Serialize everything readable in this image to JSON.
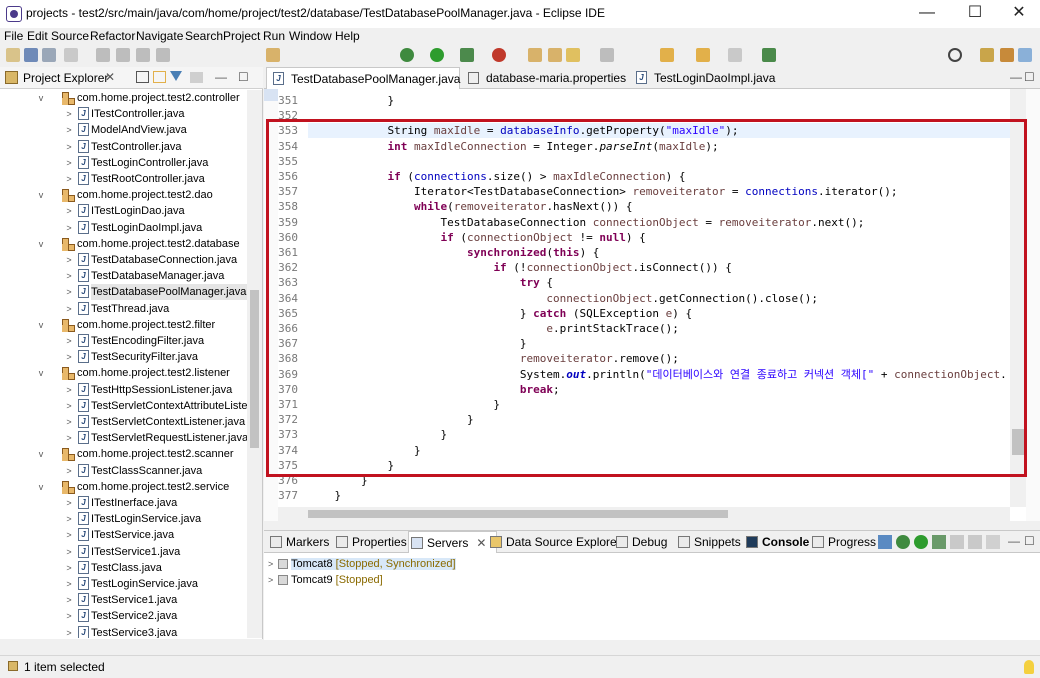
{
  "window": {
    "title": "projects - test2/src/main/java/com/home/project/test2/database/TestDatabasePoolManager.java - Eclipse IDE",
    "minimize": "—",
    "maximize": "☐",
    "close": "✕"
  },
  "menu": [
    "File",
    "Edit",
    "Source",
    "Refactor",
    "Navigate",
    "Search",
    "Project",
    "Run",
    "Window",
    "Help"
  ],
  "explorer": {
    "title": "Project Explorer",
    "items": [
      {
        "type": "pkg",
        "label": "com.home.project.test2.controller"
      },
      {
        "type": "file",
        "label": "ITestController.java"
      },
      {
        "type": "file",
        "label": "ModelAndView.java"
      },
      {
        "type": "file",
        "label": "TestController.java"
      },
      {
        "type": "file",
        "label": "TestLoginController.java"
      },
      {
        "type": "file",
        "label": "TestRootController.java"
      },
      {
        "type": "pkg",
        "label": "com.home.project.test2.dao"
      },
      {
        "type": "file",
        "label": "ITestLoginDao.java"
      },
      {
        "type": "file",
        "label": "TestLoginDaoImpl.java"
      },
      {
        "type": "pkg",
        "label": "com.home.project.test2.database"
      },
      {
        "type": "file",
        "label": "TestDatabaseConnection.java"
      },
      {
        "type": "file",
        "label": "TestDatabaseManager.java"
      },
      {
        "type": "file",
        "label": "TestDatabasePoolManager.java",
        "selected": true
      },
      {
        "type": "file",
        "label": "TestThread.java"
      },
      {
        "type": "pkg",
        "label": "com.home.project.test2.filter"
      },
      {
        "type": "file",
        "label": "TestEncodingFilter.java"
      },
      {
        "type": "file",
        "label": "TestSecurityFilter.java"
      },
      {
        "type": "pkg",
        "label": "com.home.project.test2.listener"
      },
      {
        "type": "file",
        "label": "TestHttpSessionListener.java"
      },
      {
        "type": "file",
        "label": "TestServletContextAttributeListe"
      },
      {
        "type": "file",
        "label": "TestServletContextListener.java"
      },
      {
        "type": "file",
        "label": "TestServletRequestListener.java"
      },
      {
        "type": "pkg",
        "label": "com.home.project.test2.scanner"
      },
      {
        "type": "file",
        "label": "TestClassScanner.java"
      },
      {
        "type": "pkg",
        "label": "com.home.project.test2.service"
      },
      {
        "type": "file",
        "label": "ITestInerface.java"
      },
      {
        "type": "file",
        "label": "ITestLoginService.java"
      },
      {
        "type": "file",
        "label": "ITestService.java"
      },
      {
        "type": "file",
        "label": "ITestService1.java"
      },
      {
        "type": "file",
        "label": "TestClass.java"
      },
      {
        "type": "file",
        "label": "TestLoginService.java"
      },
      {
        "type": "file",
        "label": "TestService1.java"
      },
      {
        "type": "file",
        "label": "TestService2.java"
      },
      {
        "type": "file",
        "label": "TestService3.java"
      }
    ]
  },
  "editor": {
    "tabs": [
      "TestDatabasePoolManager.java",
      "database-maria.properties",
      "TestLoginDaoImpl.java"
    ],
    "lines": [
      {
        "n": "351",
        "html": "            }"
      },
      {
        "n": "352",
        "html": ""
      },
      {
        "n": "353",
        "html": "            String <span class='lv'>maxIdle</span> = <span class='fld'>databaseInfo</span>.getProperty(<span class='str'>\"maxIdle\"</span>);"
      },
      {
        "n": "354",
        "html": "            <span class='kw'>int</span> <span class='lv'>maxIdleConnection</span> = Integer.<span class='it'>parseInt</span>(<span class='lv'>maxIdle</span>);"
      },
      {
        "n": "355",
        "html": ""
      },
      {
        "n": "356",
        "html": "            <span class='kw'>if</span> (<span class='fld'>connections</span>.size() > <span class='lv'>maxIdleConnection</span>) {"
      },
      {
        "n": "357",
        "html": "                Iterator&lt;TestDatabaseConnection&gt; <span class='lv'>removeiterator</span> = <span class='fld'>connections</span>.iterator();"
      },
      {
        "n": "358",
        "html": "                <span class='kw'>while</span>(<span class='lv'>removeiterator</span>.hasNext()) {"
      },
      {
        "n": "359",
        "html": "                    TestDatabaseConnection <span class='lv'>connectionObject</span> = <span class='lv'>removeiterator</span>.next();"
      },
      {
        "n": "360",
        "html": "                    <span class='kw'>if</span> (<span class='lv'>connectionObject</span> != <span class='kw'>null</span>) {"
      },
      {
        "n": "361",
        "html": "                        <span class='kw'>synchronized</span>(<span class='kw'>this</span>) {"
      },
      {
        "n": "362",
        "html": "                            <span class='kw'>if</span> (!<span class='lv'>connectionObject</span>.isConnect()) {"
      },
      {
        "n": "363",
        "html": "                                <span class='kw'>try</span> {"
      },
      {
        "n": "364",
        "html": "                                    <span class='lv'>connectionObject</span>.getConnection().close();"
      },
      {
        "n": "365",
        "html": "                                } <span class='kw'>catch</span> (SQLException <span class='lv'>e</span>) {"
      },
      {
        "n": "366",
        "html": "                                    <span class='lv'>e</span>.printStackTrace();"
      },
      {
        "n": "367",
        "html": "                                }"
      },
      {
        "n": "368",
        "html": "                                <span class='lv'>removeiterator</span>.remove();"
      },
      {
        "n": "369",
        "html": "                                System.<span class='sfld'>out</span>.println(<span class='str'>\"데이터베이스와 연결 종료하고 커넥션 객체[\"</span> + <span class='lv'>connectionObject</span>."
      },
      {
        "n": "370",
        "html": "                                <span class='kw'>break</span>;"
      },
      {
        "n": "371",
        "html": "                            }"
      },
      {
        "n": "372",
        "html": "                        }"
      },
      {
        "n": "373",
        "html": "                    }"
      },
      {
        "n": "374",
        "html": "                }"
      },
      {
        "n": "375",
        "html": "            }"
      },
      {
        "n": "376",
        "html": "        }"
      },
      {
        "n": "377",
        "html": "    }"
      }
    ]
  },
  "bottom": {
    "tabs": [
      "Markers",
      "Properties",
      "Servers",
      "Data Source Explorer",
      "Debug",
      "Snippets",
      "Console",
      "Progress"
    ],
    "servers": [
      {
        "name": "Tomcat8",
        "status": "[Stopped, Synchronized]"
      },
      {
        "name": "Tomcat9",
        "status": "[Stopped]"
      }
    ]
  },
  "status": {
    "text": "1 item selected"
  }
}
